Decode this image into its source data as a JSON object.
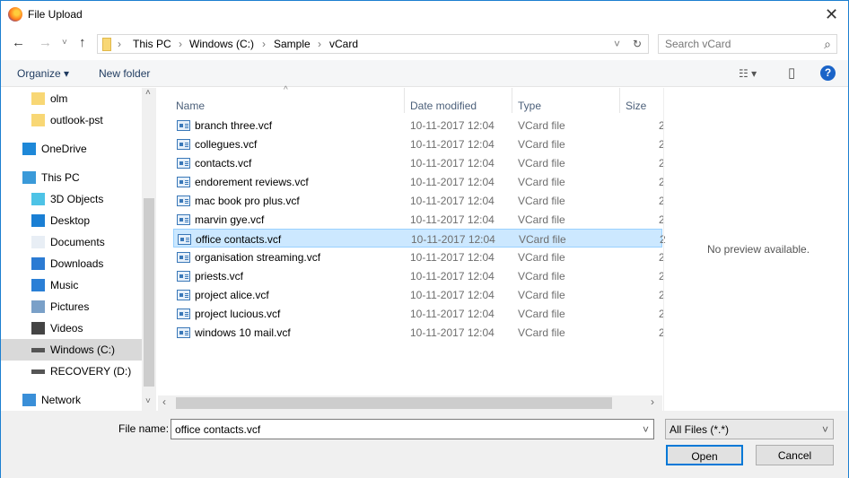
{
  "window": {
    "title": "File Upload",
    "close": "✕"
  },
  "nav": {
    "back": "←",
    "forward": "→",
    "recent": "˅",
    "up": "↑",
    "breadcrumb": [
      "This PC",
      "Windows (C:)",
      "Sample",
      "vCard"
    ],
    "refresh": "↻",
    "dropdown": "˅",
    "search_placeholder": "Search vCard",
    "search_icon": "⌕"
  },
  "toolbar": {
    "organize": "Organize ▾",
    "new_folder": "New folder",
    "view": "☷ ▾",
    "pane": "▯",
    "help": "?"
  },
  "sidebar": {
    "items": [
      {
        "label": "olm",
        "icon": "folder-icon"
      },
      {
        "label": "outlook-pst",
        "icon": "folder-icon"
      },
      {
        "label": "OneDrive",
        "icon": "cloud-icon"
      },
      {
        "label": "This PC",
        "icon": "computer-icon"
      },
      {
        "label": "3D Objects",
        "icon": "cube-icon"
      },
      {
        "label": "Desktop",
        "icon": "desktop-icon"
      },
      {
        "label": "Documents",
        "icon": "document-icon"
      },
      {
        "label": "Downloads",
        "icon": "download-icon"
      },
      {
        "label": "Music",
        "icon": "music-icon"
      },
      {
        "label": "Pictures",
        "icon": "pictures-icon"
      },
      {
        "label": "Videos",
        "icon": "videos-icon"
      },
      {
        "label": "Windows (C:)",
        "icon": "drive-icon"
      },
      {
        "label": "RECOVERY (D:)",
        "icon": "drive-icon"
      },
      {
        "label": "Network",
        "icon": "network-icon"
      }
    ],
    "scroll_up": "˄",
    "scroll_down": "˅"
  },
  "columns": {
    "name": "Name",
    "date": "Date modified",
    "type": "Type",
    "size": "Size"
  },
  "files": [
    {
      "name": "branch three.vcf",
      "date": "10-11-2017 12:04",
      "type": "VCard file",
      "size": "2"
    },
    {
      "name": "collegues.vcf",
      "date": "10-11-2017 12:04",
      "type": "VCard file",
      "size": "2"
    },
    {
      "name": "contacts.vcf",
      "date": "10-11-2017 12:04",
      "type": "VCard file",
      "size": "2"
    },
    {
      "name": "endorement reviews.vcf",
      "date": "10-11-2017 12:04",
      "type": "VCard file",
      "size": "2"
    },
    {
      "name": "mac book pro plus.vcf",
      "date": "10-11-2017 12:04",
      "type": "VCard file",
      "size": "2"
    },
    {
      "name": "marvin gye.vcf",
      "date": "10-11-2017 12:04",
      "type": "VCard file",
      "size": "2"
    },
    {
      "name": "office contacts.vcf",
      "date": "10-11-2017 12:04",
      "type": "VCard file",
      "size": "2"
    },
    {
      "name": "organisation streaming.vcf",
      "date": "10-11-2017 12:04",
      "type": "VCard file",
      "size": "2"
    },
    {
      "name": "priests.vcf",
      "date": "10-11-2017 12:04",
      "type": "VCard file",
      "size": "2"
    },
    {
      "name": "project alice.vcf",
      "date": "10-11-2017 12:04",
      "type": "VCard file",
      "size": "2"
    },
    {
      "name": "project lucious.vcf",
      "date": "10-11-2017 12:04",
      "type": "VCard file",
      "size": "2"
    },
    {
      "name": "windows 10 mail.vcf",
      "date": "10-11-2017 12:04",
      "type": "VCard file",
      "size": "2"
    }
  ],
  "selected_index": 6,
  "hscroll": {
    "left": "‹",
    "right": "›"
  },
  "preview": "No preview available.",
  "bottom": {
    "file_name_label": "File name:",
    "file_name_value": "office contacts.vcf",
    "file_type": "All Files (*.*)",
    "dropdown": "˅",
    "open": "Open",
    "cancel": "Cancel"
  }
}
